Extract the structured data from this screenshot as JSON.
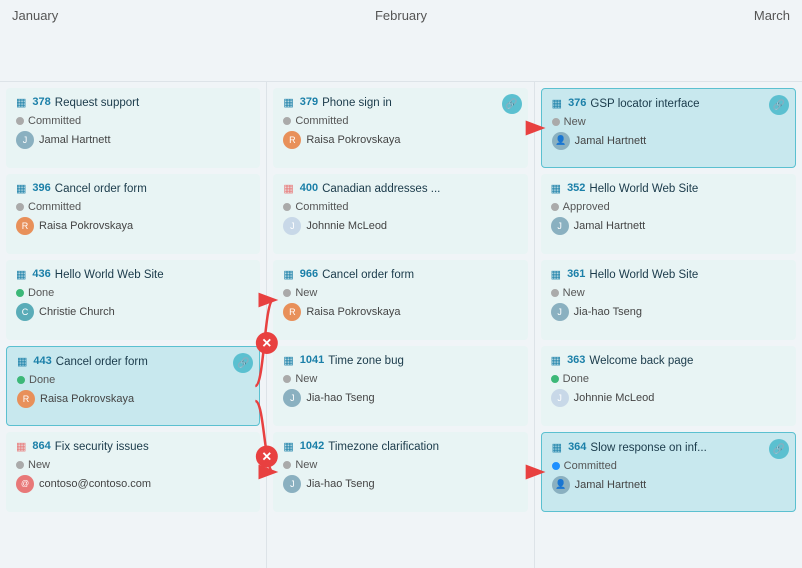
{
  "columns": [
    {
      "id": "january",
      "label": "January",
      "cards": [
        {
          "id": "378",
          "title": "Request support",
          "status": "Committed",
          "statusType": "committed",
          "user": "Jamal Hartnett",
          "avatarType": "gray",
          "hasLink": false,
          "highlighted": false
        },
        {
          "id": "396",
          "title": "Cancel order form",
          "status": "Committed",
          "statusType": "committed",
          "user": "Raisa Pokrovskaya",
          "avatarType": "orange",
          "hasLink": false,
          "highlighted": false
        },
        {
          "id": "436",
          "title": "Hello World Web Site",
          "status": "Done",
          "statusType": "done",
          "user": "Christie Church",
          "avatarType": "teal",
          "hasLink": false,
          "highlighted": false
        },
        {
          "id": "443",
          "title": "Cancel order form",
          "status": "Done",
          "statusType": "done",
          "user": "Raisa Pokrovskaya",
          "avatarType": "orange",
          "hasLink": true,
          "highlighted": true
        },
        {
          "id": "864",
          "title": "Fix security issues",
          "status": "New",
          "statusType": "new",
          "user": "contoso@contoso.com",
          "avatarType": "pink",
          "hasLink": false,
          "highlighted": false
        }
      ]
    },
    {
      "id": "february",
      "label": "February",
      "cards": [
        {
          "id": "379",
          "title": "Phone sign in",
          "status": "Committed",
          "statusType": "committed",
          "user": "Raisa Pokrovskaya",
          "avatarType": "orange",
          "hasLink": true,
          "highlighted": false
        },
        {
          "id": "400",
          "title": "Canadian addresses ...",
          "status": "Committed",
          "statusType": "committed",
          "user": "Johnnie McLeod",
          "avatarType": "light",
          "hasLink": false,
          "highlighted": false
        },
        {
          "id": "966",
          "title": "Cancel order form",
          "status": "New",
          "statusType": "new",
          "user": "Raisa Pokrovskaya",
          "avatarType": "orange",
          "hasLink": false,
          "highlighted": false
        },
        {
          "id": "1041",
          "title": "Time zone bug",
          "status": "New",
          "statusType": "new",
          "user": "Jia-hao Tseng",
          "avatarType": "gray",
          "hasLink": false,
          "highlighted": false
        },
        {
          "id": "1042",
          "title": "Timezone clarification",
          "status": "New",
          "statusType": "new",
          "user": "Jia-hao Tseng",
          "avatarType": "gray",
          "hasLink": false,
          "highlighted": false
        }
      ]
    },
    {
      "id": "march",
      "label": "March",
      "cards": [
        {
          "id": "376",
          "title": "GSP locator interface",
          "status": "New",
          "statusType": "new",
          "user": "Jamal Hartnett",
          "avatarType": "gray",
          "hasLink": true,
          "highlighted": true
        },
        {
          "id": "352",
          "title": "Hello World Web Site",
          "status": "Approved",
          "statusType": "approved",
          "user": "Jamal Hartnett",
          "avatarType": "gray",
          "hasLink": false,
          "highlighted": false
        },
        {
          "id": "361",
          "title": "Hello World Web Site",
          "status": "New",
          "statusType": "new",
          "user": "Jia-hao Tseng",
          "avatarType": "gray",
          "hasLink": false,
          "highlighted": false
        },
        {
          "id": "363",
          "title": "Welcome back page",
          "status": "Done",
          "statusType": "done",
          "user": "Johnnie McLeod",
          "avatarType": "light",
          "hasLink": false,
          "highlighted": false
        },
        {
          "id": "364",
          "title": "Slow response on inf...",
          "status": "Committed",
          "statusType": "committed",
          "user": "Jamal Hartnett",
          "avatarType": "gray",
          "hasLink": true,
          "highlighted": true
        }
      ]
    }
  ],
  "connections": [
    {
      "from": "379",
      "to": "376",
      "type": "link"
    },
    {
      "from": "443",
      "to": "966",
      "type": "cross"
    },
    {
      "from": "443",
      "to": "1042",
      "type": "cross"
    },
    {
      "from": "1042",
      "to": "364",
      "type": "link"
    }
  ]
}
